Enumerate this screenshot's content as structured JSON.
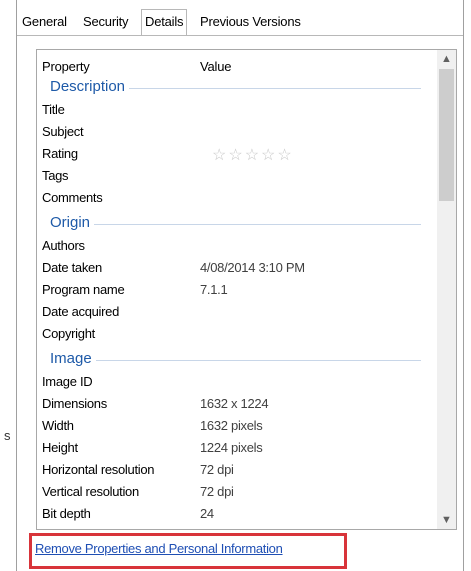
{
  "tabs": [
    {
      "label": "General"
    },
    {
      "label": "Security"
    },
    {
      "label": "Details"
    },
    {
      "label": "Previous Versions"
    }
  ],
  "active_tab": "Details",
  "table": {
    "header_property": "Property",
    "header_value": "Value"
  },
  "groups": {
    "description": "Description",
    "origin": "Origin",
    "image": "Image"
  },
  "rows": {
    "title": {
      "k": "Title",
      "v": ""
    },
    "subject": {
      "k": "Subject",
      "v": ""
    },
    "rating": {
      "k": "Rating",
      "v": "☆☆☆☆☆",
      "stars": 0
    },
    "tags": {
      "k": "Tags",
      "v": ""
    },
    "comments": {
      "k": "Comments",
      "v": ""
    },
    "authors": {
      "k": "Authors",
      "v": ""
    },
    "date_taken": {
      "k": "Date taken",
      "v": "4/08/2014 3:10 PM"
    },
    "program_name": {
      "k": "Program name",
      "v": "7.1.1"
    },
    "date_acquired": {
      "k": "Date acquired",
      "v": ""
    },
    "copyright": {
      "k": "Copyright",
      "v": ""
    },
    "image_id": {
      "k": "Image ID",
      "v": ""
    },
    "dimensions": {
      "k": "Dimensions",
      "v": "1632 x 1224"
    },
    "width": {
      "k": "Width",
      "v": "1632 pixels"
    },
    "height": {
      "k": "Height",
      "v": "1224 pixels"
    },
    "horizontal_resolution": {
      "k": "Horizontal resolution",
      "v": "72 dpi"
    },
    "vertical_resolution": {
      "k": "Vertical resolution",
      "v": "72 dpi"
    },
    "bit_depth": {
      "k": "Bit depth",
      "v": "24"
    }
  },
  "scroll": {
    "up_icon": "▲",
    "down_icon": "▼"
  },
  "remove_link": "Remove Properties and Personal Information",
  "stray_char": "s",
  "colors": {
    "group_title": "#1e5aa8",
    "link": "#1f4fb4",
    "highlight": "#d8343a"
  }
}
